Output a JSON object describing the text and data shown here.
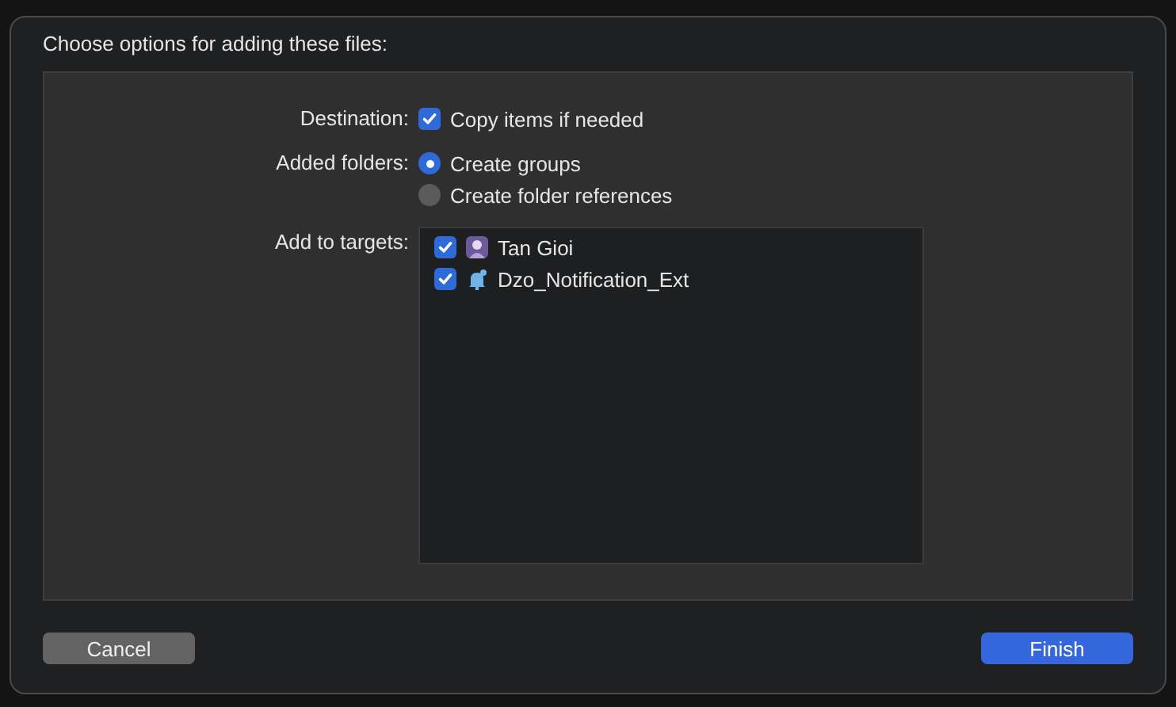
{
  "title": "Choose options for adding these files:",
  "destination": {
    "label": "Destination:",
    "option": {
      "label": "Copy items if needed",
      "checked": true
    }
  },
  "added_folders": {
    "label": "Added folders:",
    "options": [
      {
        "label": "Create groups",
        "selected": true
      },
      {
        "label": "Create folder references",
        "selected": false
      }
    ]
  },
  "targets": {
    "label": "Add to targets:",
    "items": [
      {
        "name": "Tan Gioi",
        "kind": "app",
        "checked": true
      },
      {
        "name": "Dzo_Notification_Ext",
        "kind": "extension",
        "checked": true
      }
    ]
  },
  "buttons": [
    {
      "label": "Cancel",
      "kind": "secondary"
    },
    {
      "label": "Finish",
      "kind": "primary"
    }
  ]
}
